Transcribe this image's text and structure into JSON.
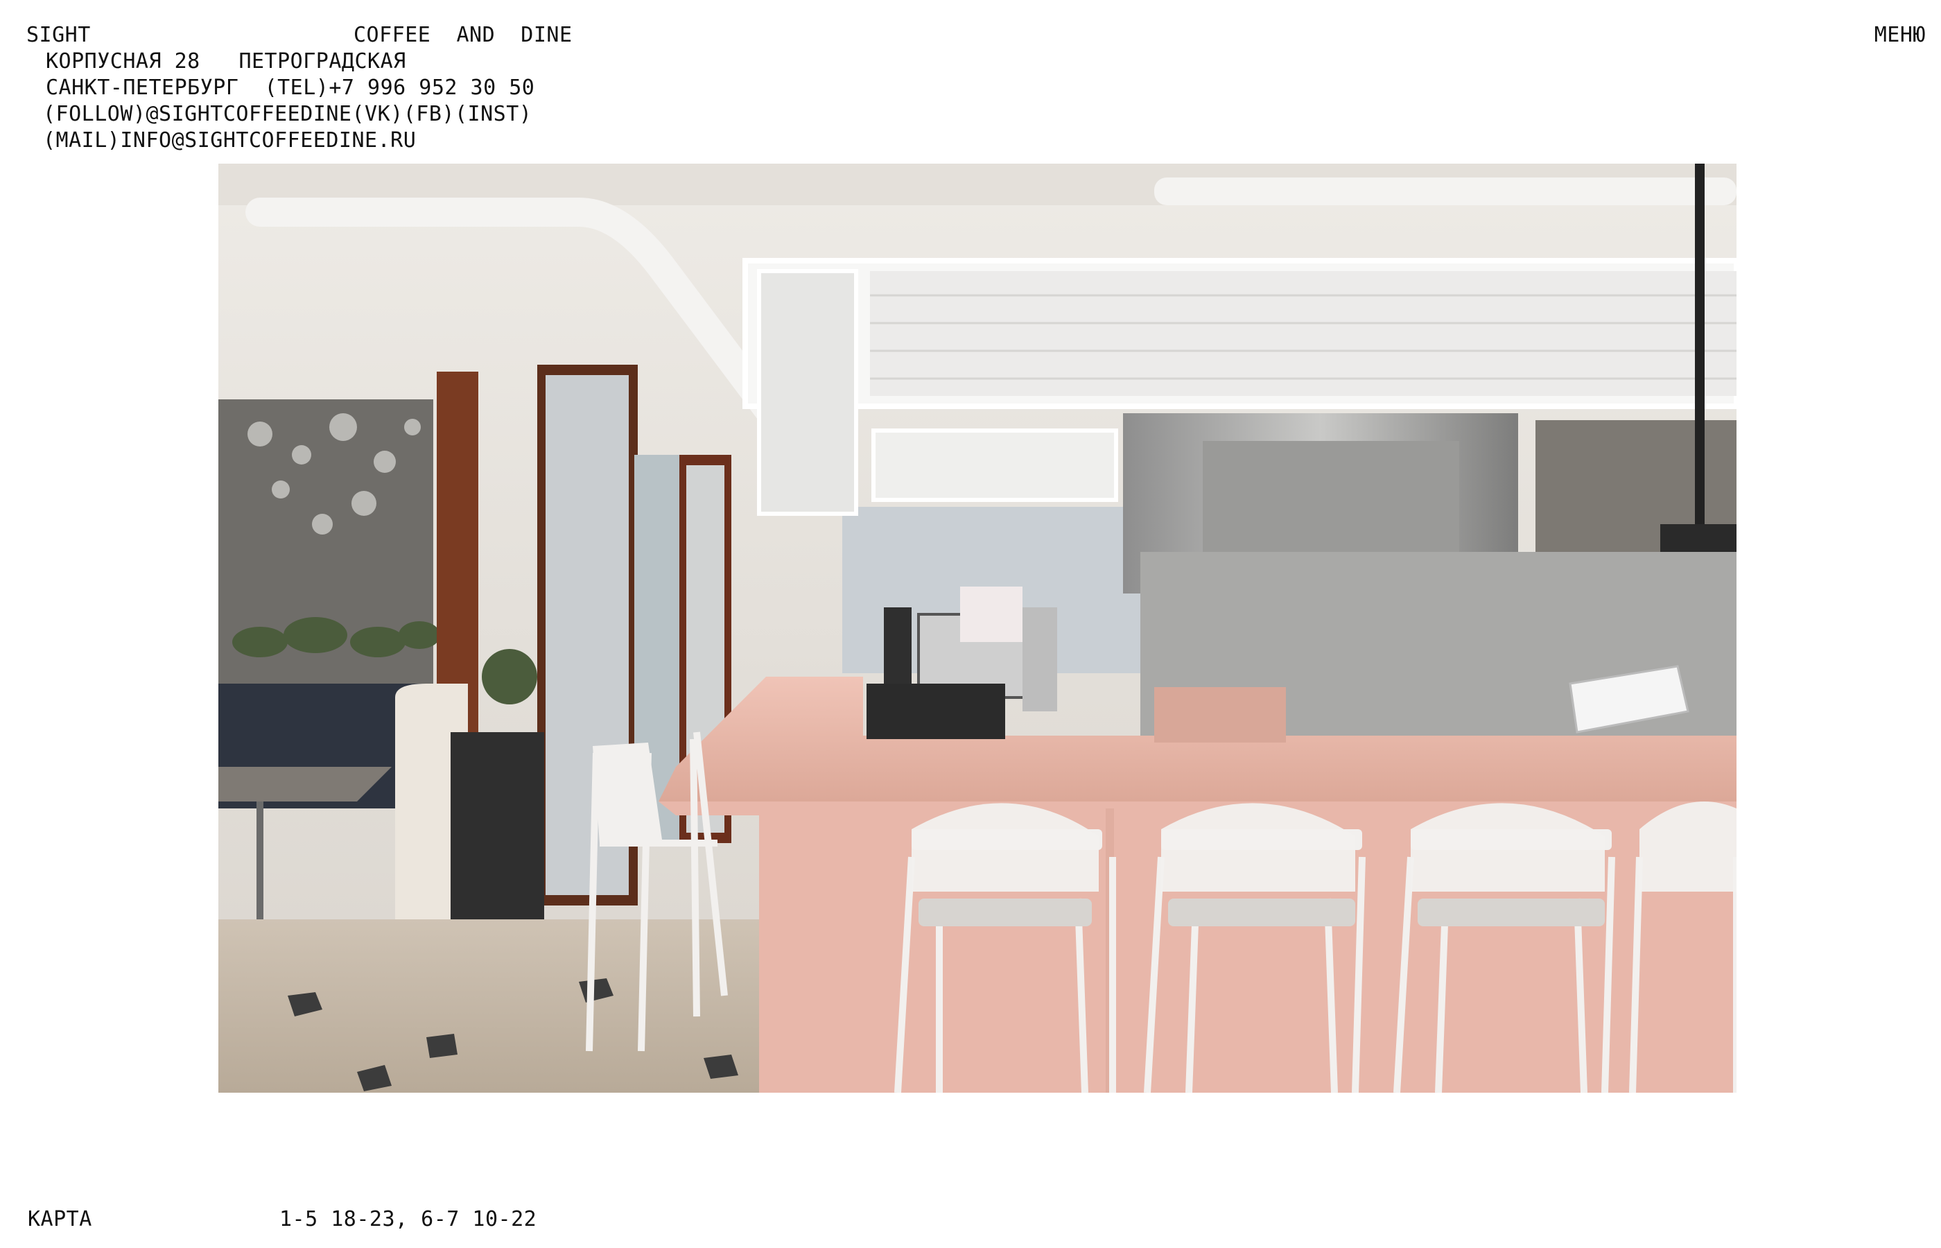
{
  "header": {
    "brand": "SIGHT",
    "tagline": "COFFEE  AND  DINE",
    "menu_label": "МЕНЮ"
  },
  "contact": {
    "address": "КОРПУСНАЯ 28",
    "district": "ПЕТРОГРАДСКАЯ",
    "city": "САНКТ-ПЕТЕРБУРГ",
    "tel_label": "(TEL)",
    "tel": "+7 996 952 30 50",
    "follow_label": "(FOLLOW)",
    "handle": "@SIGHTCOFFEEDINE",
    "vk": "(VK)",
    "fb": "(FB)",
    "inst": "(INST)",
    "mail_label": "(MAIL)",
    "email": "INFO@SIGHTCOFFEEDINE.RU"
  },
  "footer": {
    "map_label": "КАРТА",
    "hours": "1-5 18-23, 6-7 10-22"
  },
  "colors": {
    "background": "#ffffff",
    "text": "#111111",
    "counter_pink": "#e8b7aa",
    "stool_white": "#f2f0ee"
  }
}
